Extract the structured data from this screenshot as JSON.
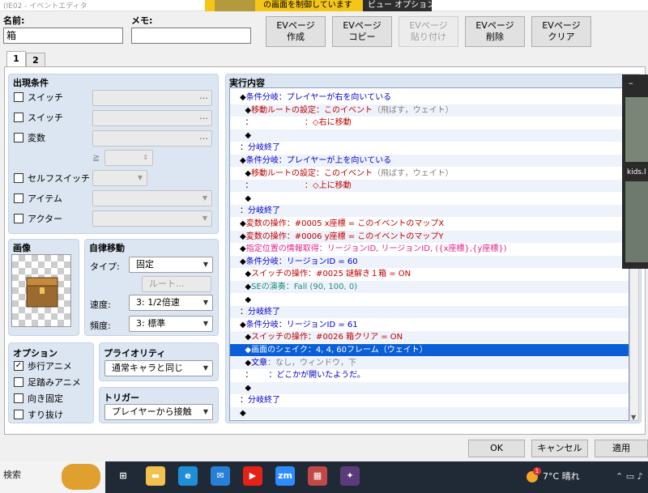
{
  "window": {
    "title": "(IE02 - イベントエディタ",
    "remote_banner": "の画面を制御しています",
    "view_options": "ビュー オプション ⌄"
  },
  "fields": {
    "name_label": "名前:",
    "name_value": "箱",
    "memo_label": "メモ:",
    "memo_value": ""
  },
  "toolbar": {
    "buttons": [
      {
        "line1": "EVページ",
        "line2": "作成",
        "enabled": true
      },
      {
        "line1": "EVページ",
        "line2": "コピー",
        "enabled": true
      },
      {
        "line1": "EVページ",
        "line2": "貼り付け",
        "enabled": false
      },
      {
        "line1": "EVページ",
        "line2": "削除",
        "enabled": true
      },
      {
        "line1": "EVページ",
        "line2": "クリア",
        "enabled": true
      }
    ]
  },
  "tabs": [
    "1",
    "2"
  ],
  "conditions": {
    "title": "出現条件",
    "items": [
      {
        "label": "スイッチ"
      },
      {
        "label": "スイッチ"
      },
      {
        "label": "変数"
      },
      {
        "label": "≧"
      },
      {
        "label": "セルフスイッチ"
      },
      {
        "label": "アイテム"
      },
      {
        "label": "アクター"
      }
    ]
  },
  "image_group": {
    "title": "画像"
  },
  "autonomous": {
    "title": "自律移動",
    "type_label": "タイプ:",
    "type_value": "固定",
    "route_button": "ルート...",
    "speed_label": "速度:",
    "speed_value": "3: 1/2倍速",
    "freq_label": "頻度:",
    "freq_value": "3: 標準"
  },
  "options": {
    "title": "オプション",
    "items": [
      {
        "label": "歩行アニメ",
        "checked": "✓"
      },
      {
        "label": "足踏みアニメ",
        "checked": ""
      },
      {
        "label": "向き固定",
        "checked": ""
      },
      {
        "label": "すり抜け",
        "checked": ""
      }
    ]
  },
  "priority": {
    "title": "プライオリティ",
    "value": "通常キャラと同じ"
  },
  "trigger": {
    "title": "トリガー",
    "value": "プレイヤーから接触"
  },
  "exec": {
    "title": "実行内容",
    "rows": [
      [
        {
          "t": "◆"
        },
        {
          "t": "条件分岐：プレイヤーが右を向いている",
          "c": "key"
        }
      ],
      [
        {
          "t": "  ◆"
        },
        {
          "t": "移動ルートの設定：このイベント",
          "c": "red"
        },
        {
          "t": "（飛ばす，ウェイト）",
          "c": "gray"
        }
      ],
      [
        {
          "t": "  ："
        },
        {
          "t": "                    ：◇右に移動",
          "c": "red"
        }
      ],
      [
        {
          "t": "  ◆"
        }
      ],
      [
        {
          "t": "："
        },
        {
          "t": "分岐終了",
          "c": "key"
        }
      ],
      [
        {
          "t": "◆"
        },
        {
          "t": "条件分岐：プレイヤーが上を向いている",
          "c": "key"
        }
      ],
      [
        {
          "t": "  ◆"
        },
        {
          "t": "移動ルートの設定：このイベント",
          "c": "red"
        },
        {
          "t": "（飛ばす，ウェイト）",
          "c": "gray"
        }
      ],
      [
        {
          "t": "  ："
        },
        {
          "t": "                    ：◇上に移動",
          "c": "red"
        }
      ],
      [
        {
          "t": "  ◆"
        }
      ],
      [
        {
          "t": "："
        },
        {
          "t": "分岐終了",
          "c": "key"
        }
      ],
      [
        {
          "t": "◆"
        },
        {
          "t": "変数の操作：#0005 x座標 = このイベントのマップX",
          "c": "red"
        }
      ],
      [
        {
          "t": "◆"
        },
        {
          "t": "変数の操作：#0006 y座標 = このイベントのマップY",
          "c": "red"
        }
      ],
      [
        {
          "t": "◆"
        },
        {
          "t": "指定位置の情報取得：リージョンID, リージョンID, ({x座標},{y座標})",
          "c": "pink"
        }
      ],
      [
        {
          "t": "◆"
        },
        {
          "t": "条件分岐：リージョンID = 60",
          "c": "key"
        }
      ],
      [
        {
          "t": "  ◆"
        },
        {
          "t": "スイッチの操作：#0025 謎解き１箱 = ON",
          "c": "red"
        }
      ],
      [
        {
          "t": "  ◆"
        },
        {
          "t": "SEの演奏：Fall (90, 100, 0)",
          "c": "teal"
        }
      ],
      [
        {
          "t": "  ◆"
        }
      ],
      [
        {
          "t": "："
        },
        {
          "t": "分岐終了",
          "c": "key"
        }
      ],
      [
        {
          "t": "◆"
        },
        {
          "t": "条件分岐：リージョンID = 61",
          "c": "key"
        }
      ],
      [
        {
          "t": "  ◆"
        },
        {
          "t": "スイッチの操作：#0026 箱クリア = ON",
          "c": "red"
        }
      ],
      [
        {
          "t": "  ◆"
        },
        {
          "t": "画面のシェイク：4, 4, 60フレーム（ウェイト）",
          "c": "key"
        }
      ],
      [
        {
          "t": "  ◆"
        },
        {
          "t": "文章",
          "c": "key"
        },
        {
          "t": "：なし，ウィンドウ，下",
          "c": "gray"
        }
      ],
      [
        {
          "t": "  ："
        },
        {
          "t": "      ：どこかが開いたようだ。",
          "c": "key"
        }
      ],
      [
        {
          "t": "  ◆"
        }
      ],
      [
        {
          "t": "："
        },
        {
          "t": "分岐終了",
          "c": "key"
        }
      ],
      [
        {
          "t": "◆"
        }
      ]
    ],
    "selected_index": 20
  },
  "overlay": {
    "name": "kids.l",
    "minimize": "–"
  },
  "bottom": {
    "ok": "OK",
    "cancel": "キャンセル",
    "apply": "適用"
  },
  "taskbar": {
    "search": "検索",
    "icons": [
      {
        "name": "task-view-icon",
        "glyph": "⊞",
        "color": "#1f2a36"
      },
      {
        "name": "explorer-icon",
        "glyph": "▬",
        "color": "#f2c14e"
      },
      {
        "name": "edge-icon",
        "glyph": "e",
        "color": "#1d8fd8"
      },
      {
        "name": "mail-icon",
        "glyph": "✉",
        "color": "#2680d8"
      },
      {
        "name": "youtube-icon",
        "glyph": "▶",
        "color": "#e62117"
      },
      {
        "name": "zoom-icon",
        "glyph": "zm",
        "color": "#2d8cff"
      },
      {
        "name": "rpgmaker-icon",
        "glyph": "▦",
        "color": "#c24848"
      },
      {
        "name": "game-icon",
        "glyph": "✦",
        "color": "#5a3c7a"
      }
    ],
    "weather_temp": "7°C",
    "weather_text": "晴れ",
    "weather_badge": "1",
    "tray": "⌃ ▭ ♪"
  }
}
